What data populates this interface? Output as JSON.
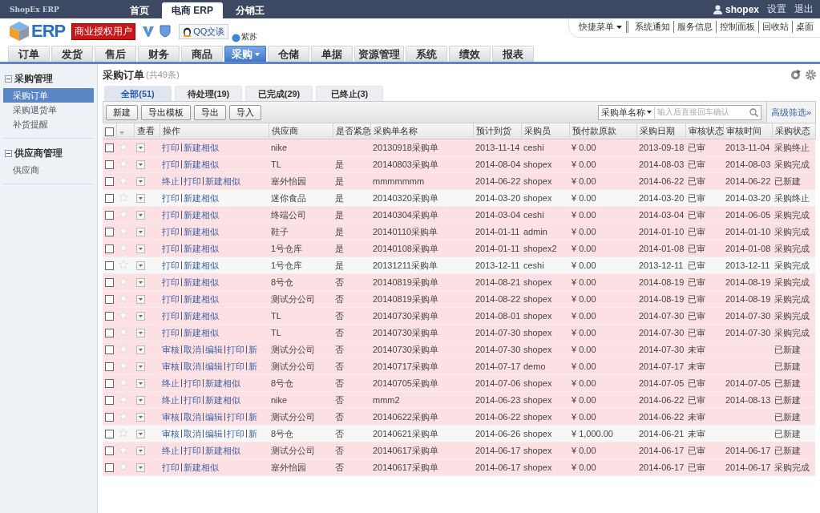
{
  "top_bar": {
    "brand": "ShopEx ERP",
    "tabs": [
      {
        "label": "首页",
        "selected": false
      },
      {
        "label": "电商 ERP",
        "selected": true
      },
      {
        "label": "分销王",
        "selected": false
      }
    ],
    "user": "shopex",
    "links": [
      "设置",
      "退出"
    ]
  },
  "header": {
    "logo": "ERP",
    "license_badge": "商业授权用户",
    "qq_button": "QQ交谈",
    "contact": "紫苏",
    "quick_menu": "快捷菜单",
    "quick_links": [
      "系统通知",
      "服务信息",
      "控制面板",
      "回收站",
      "桌面"
    ]
  },
  "nav": [
    {
      "label": "订单",
      "selected": false
    },
    {
      "label": "发货",
      "selected": false
    },
    {
      "label": "售后",
      "selected": false
    },
    {
      "label": "财务",
      "selected": false
    },
    {
      "label": "商品",
      "selected": false
    },
    {
      "label": "采购",
      "selected": true,
      "dropdown": true
    },
    {
      "label": "仓储",
      "selected": false
    },
    {
      "label": "单据",
      "selected": false
    },
    {
      "label": "资源管理",
      "selected": false
    },
    {
      "label": "系统",
      "selected": false
    },
    {
      "label": "绩效",
      "selected": false
    },
    {
      "label": "报表",
      "selected": false
    }
  ],
  "sidebar": [
    {
      "title": "采购管理",
      "expanded": true,
      "items": [
        {
          "label": "采购订单",
          "selected": true
        },
        {
          "label": "采购退货单",
          "selected": false
        },
        {
          "label": "补货提醒",
          "selected": false
        }
      ]
    },
    {
      "title": "供应商管理",
      "expanded": true,
      "items": [
        {
          "label": "供应商",
          "selected": false
        }
      ]
    }
  ],
  "page": {
    "title": "采购订单",
    "count": "(共49条)",
    "tabs": [
      {
        "label": "全部(51)",
        "selected": true
      },
      {
        "label": "待处理(19)",
        "selected": false
      },
      {
        "label": "已完成(29)",
        "selected": false
      },
      {
        "label": "已终止(3)",
        "selected": false
      }
    ],
    "buttons": [
      "新建",
      "导出模板",
      "导出",
      "导入"
    ],
    "search": {
      "field": "采购单名称",
      "placeholder": "输入后直接回车确认"
    },
    "advanced_filter": "高级筛选»"
  },
  "table": {
    "select_all_checked": false,
    "columns": [
      "查看",
      "操作",
      "供应商",
      "是否紧急",
      "采购单名称",
      "预计到货",
      "采购员",
      "预付款原款",
      "采购日期",
      "审核状态",
      "审核时间",
      "采购状态"
    ],
    "rows": [
      {
        "checked": false,
        "starred": false,
        "highlighted": true,
        "actions": [
          "打印",
          "新建相似"
        ],
        "supplier": "nike",
        "name": "20130918采购单",
        "eta": "2013-11-14",
        "buyer": "ceshi",
        "prepay": "¥ 0.00",
        "date": "2013-09-18",
        "audit": "已审",
        "audit_time": "2013-11-04",
        "status": "采购终止"
      },
      {
        "checked": false,
        "starred": false,
        "highlighted": true,
        "actions": [
          "打印",
          "新建相似"
        ],
        "supplier": "TL",
        "urgent": "是",
        "name": "20140803采购单",
        "eta": "2014-08-04",
        "buyer": "shopex",
        "prepay": "¥ 0.00",
        "date": "2014-08-03",
        "audit": "已审",
        "audit_time": "2014-08-03",
        "status": "采购完成"
      },
      {
        "checked": false,
        "starred": false,
        "highlighted": true,
        "actions": [
          "终止",
          "打印",
          "新建相似"
        ],
        "supplier": "塞外怡园",
        "urgent": "是",
        "name": "mmmmmmm",
        "eta": "2014-06-22",
        "buyer": "shopex",
        "prepay": "¥ 0.00",
        "date": "2014-06-22",
        "audit": "已审",
        "audit_time": "2014-06-22",
        "status": "已新建"
      },
      {
        "checked": false,
        "starred": false,
        "highlighted": false,
        "actions": [
          "打印",
          "新建相似"
        ],
        "supplier": "迷你食品",
        "urgent": "是",
        "name": "20140320采购单",
        "eta": "2014-03-20",
        "buyer": "shopex",
        "prepay": "¥ 0.00",
        "date": "2014-03-20",
        "audit": "已审",
        "audit_time": "2014-03-20",
        "status": "采购终止"
      },
      {
        "checked": false,
        "starred": false,
        "highlighted": true,
        "actions": [
          "打印",
          "新建相似"
        ],
        "supplier": "终端公司",
        "urgent": "是",
        "name": "20140304采购单",
        "eta": "2014-03-04",
        "buyer": "ceshi",
        "prepay": "¥ 0.00",
        "date": "2014-03-04",
        "audit": "已审",
        "audit_time": "2014-06-05",
        "status": "采购完成"
      },
      {
        "checked": false,
        "starred": false,
        "highlighted": true,
        "actions": [
          "打印",
          "新建相似"
        ],
        "supplier": "鞋子",
        "urgent": "是",
        "name": "20140110采购单",
        "eta": "2014-01-11",
        "buyer": "admin",
        "prepay": "¥ 0.00",
        "date": "2014-01-10",
        "audit": "已审",
        "audit_time": "2014-01-10",
        "status": "采购完成"
      },
      {
        "checked": false,
        "starred": false,
        "highlighted": true,
        "actions": [
          "打印",
          "新建相似"
        ],
        "supplier": "1号仓库",
        "urgent": "是",
        "name": "20140108采购单",
        "eta": "2014-01-11",
        "buyer": "shopex2",
        "prepay": "¥ 0.00",
        "date": "2014-01-08",
        "audit": "已审",
        "audit_time": "2014-01-08",
        "status": "采购完成"
      },
      {
        "checked": false,
        "starred": false,
        "highlighted": false,
        "actions": [
          "打印",
          "新建相似"
        ],
        "supplier": "1号仓库",
        "urgent": "是",
        "name": "20131211采购单",
        "eta": "2013-12-11",
        "buyer": "ceshi",
        "prepay": "¥ 0.00",
        "date": "2013-12-11",
        "audit": "已审",
        "audit_time": "2013-12-11",
        "status": "采购完成"
      },
      {
        "checked": false,
        "starred": false,
        "highlighted": true,
        "actions": [
          "打印",
          "新建相似"
        ],
        "supplier": "8号仓",
        "urgent": "否",
        "name": "20140819采购单",
        "eta": "2014-08-21",
        "buyer": "shopex",
        "prepay": "¥ 0.00",
        "date": "2014-08-19",
        "audit": "已审",
        "audit_time": "2014-08-19",
        "status": "采购完成"
      },
      {
        "checked": false,
        "starred": false,
        "highlighted": true,
        "actions": [
          "打印",
          "新建相似"
        ],
        "supplier": "测试分公司",
        "urgent": "否",
        "name": "20140819采购单",
        "eta": "2014-08-22",
        "buyer": "shopex",
        "prepay": "¥ 0.00",
        "date": "2014-08-19",
        "audit": "已审",
        "audit_time": "2014-08-19",
        "status": "采购完成"
      },
      {
        "checked": false,
        "starred": false,
        "highlighted": true,
        "actions": [
          "打印",
          "新建相似"
        ],
        "supplier": "TL",
        "urgent": "否",
        "name": "20140730采购单",
        "eta": "2014-08-01",
        "buyer": "shopex",
        "prepay": "¥ 0.00",
        "date": "2014-07-30",
        "audit": "已审",
        "audit_time": "2014-07-30",
        "status": "采购完成"
      },
      {
        "checked": false,
        "starred": false,
        "highlighted": true,
        "actions": [
          "打印",
          "新建相似"
        ],
        "supplier": "TL",
        "urgent": "否",
        "name": "20140730采购单",
        "eta": "2014-07-30",
        "buyer": "shopex",
        "prepay": "¥ 0.00",
        "date": "2014-07-30",
        "audit": "已审",
        "audit_time": "2014-07-30",
        "status": "采购完成"
      },
      {
        "checked": false,
        "starred": false,
        "highlighted": true,
        "actions": [
          "审核",
          "取消",
          "编辑",
          "打印",
          "新"
        ],
        "supplier": "测试分公司",
        "urgent": "否",
        "name": "20140730采购单",
        "eta": "2014-07-30",
        "buyer": "shopex",
        "prepay": "¥ 0.00",
        "date": "2014-07-30",
        "audit": "未审",
        "status": "已新建"
      },
      {
        "checked": false,
        "starred": false,
        "highlighted": true,
        "actions": [
          "审核",
          "取消",
          "编辑",
          "打印",
          "新"
        ],
        "supplier": "测试分公司",
        "urgent": "否",
        "name": "20140717采购单",
        "eta": "2014-07-17",
        "buyer": "demo",
        "prepay": "¥ 0.00",
        "date": "2014-07-17",
        "audit": "未审",
        "status": "已新建"
      },
      {
        "checked": false,
        "starred": false,
        "highlighted": true,
        "actions": [
          "终止",
          "打印",
          "新建相似"
        ],
        "supplier": "8号仓",
        "urgent": "否",
        "name": "20140705采购单",
        "eta": "2014-07-06",
        "buyer": "shopex",
        "prepay": "¥ 0.00",
        "date": "2014-07-05",
        "audit": "已审",
        "audit_time": "2014-07-05",
        "status": "已新建"
      },
      {
        "checked": false,
        "starred": false,
        "highlighted": true,
        "actions": [
          "终止",
          "打印",
          "新建相似"
        ],
        "supplier": "nike",
        "urgent": "否",
        "name": "mmm2",
        "eta": "2014-06-23",
        "buyer": "shopex",
        "prepay": "¥ 0.00",
        "date": "2014-06-22",
        "audit": "已审",
        "audit_time": "2014-08-13",
        "status": "已新建"
      },
      {
        "checked": false,
        "starred": false,
        "highlighted": true,
        "actions": [
          "审核",
          "取消",
          "编辑",
          "打印",
          "新"
        ],
        "supplier": "测试分公司",
        "urgent": "否",
        "name": "20140622采购单",
        "eta": "2014-06-22",
        "buyer": "shopex",
        "prepay": "¥ 0.00",
        "date": "2014-06-22",
        "audit": "未审",
        "status": "已新建"
      },
      {
        "checked": false,
        "starred": false,
        "highlighted": false,
        "actions": [
          "审核",
          "取消",
          "编辑",
          "打印",
          "新"
        ],
        "supplier": "8号仓",
        "urgent": "否",
        "name": "20140621采购单",
        "eta": "2014-06-26",
        "buyer": "shopex",
        "prepay": "¥ 1,000.00",
        "date": "2014-06-21",
        "audit": "未审",
        "status": "已新建"
      },
      {
        "checked": false,
        "starred": false,
        "highlighted": true,
        "actions": [
          "终止",
          "打印",
          "新建相似"
        ],
        "supplier": "测试分公司",
        "urgent": "否",
        "name": "20140617采购单",
        "eta": "2014-06-17",
        "buyer": "shopex",
        "prepay": "¥ 0.00",
        "date": "2014-06-17",
        "audit": "已审",
        "audit_time": "2014-06-17",
        "status": "已新建"
      },
      {
        "checked": false,
        "starred": false,
        "highlighted": true,
        "actions": [
          "打印",
          "新建相似"
        ],
        "supplier": "塞外怡园",
        "urgent": "否",
        "name": "20140617采购单",
        "eta": "2014-06-17",
        "buyer": "shopex",
        "prepay": "¥ 0.00",
        "date": "2014-06-17",
        "audit": "已审",
        "audit_time": "2014-06-17",
        "status": "采购完成"
      }
    ]
  }
}
